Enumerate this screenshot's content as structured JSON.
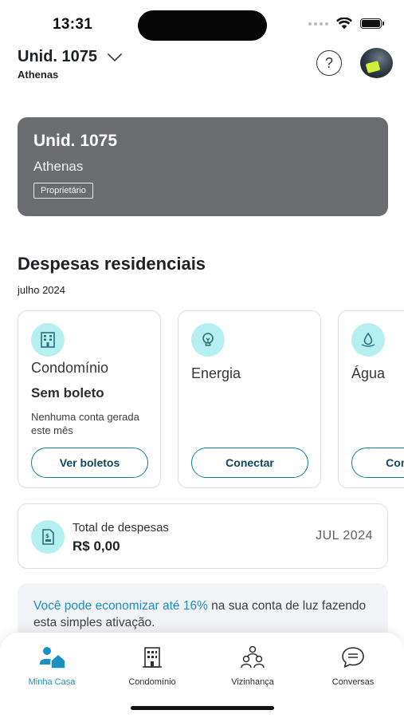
{
  "status_bar": {
    "time": "13:31"
  },
  "header": {
    "unit_title": "Unid. 1075",
    "unit_subtitle": "Athenas",
    "help_symbol": "?",
    "help_icon": "question-circle-icon",
    "avatar_icon": "user-avatar"
  },
  "unit_card": {
    "title": "Unid. 1075",
    "city": "Athenas",
    "role": "Proprietário"
  },
  "expenses": {
    "title": "Despesas residenciais",
    "month": "julho 2024",
    "cards": [
      {
        "icon": "building-icon",
        "title": "Condomínio",
        "status": "Sem boleto",
        "description": "Nenhuma conta gerada este mês",
        "button": "Ver boletos"
      },
      {
        "icon": "lightbulb-icon",
        "title": "Energia",
        "status": "",
        "description": "",
        "button": "Conectar"
      },
      {
        "icon": "water-drop-icon",
        "title": "Água",
        "status": "",
        "description": "",
        "button": "Conectar"
      }
    ]
  },
  "total": {
    "icon": "receipt-icon",
    "label": "Total de despesas",
    "value": "R$ 0,00",
    "month": "JUL 2024"
  },
  "promo": {
    "highlight": "Você pode economizar até 16%",
    "text": " na sua conta de luz fazendo esta simples ativação."
  },
  "nav": {
    "items": [
      {
        "label": "Minha Casa",
        "icon": "home-user-icon",
        "active": true
      },
      {
        "label": "Condomínio",
        "icon": "building-icon",
        "active": false
      },
      {
        "label": "Vizinhança",
        "icon": "people-icon",
        "active": false
      },
      {
        "label": "Conversas",
        "icon": "chat-bubble-icon",
        "active": false
      }
    ]
  },
  "colors": {
    "accent": "#1b8fbf",
    "icon_bg": "#b5eff2",
    "card_gray": "#6b6c6f"
  }
}
